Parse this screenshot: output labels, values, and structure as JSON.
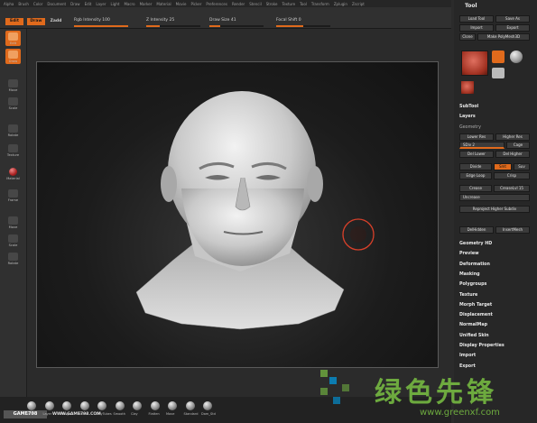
{
  "menu": {
    "items": [
      "Alpha",
      "Brush",
      "Color",
      "Document",
      "Draw",
      "Edit",
      "Layer",
      "Light",
      "Macro",
      "Marker",
      "Material",
      "Movie",
      "Picker",
      "Preferences",
      "Render",
      "Stencil",
      "Stroke",
      "Texture",
      "Tool",
      "Transform",
      "Zplugin",
      "Zscript"
    ]
  },
  "topbar": {
    "edit_label": "Edit",
    "draw_label": "Draw",
    "zadd_label": "Zadd",
    "rgb_intensity": "Rgb Intensity 100",
    "z_intensity": "Z Intensity 25",
    "draw_size": "Draw Size 41",
    "focal_shift": "Focal Shift 0",
    "rgb_fill": 1.0,
    "z_fill": 0.25,
    "draw_fill": 0.2,
    "focal_fill": 0.5
  },
  "right_panel": {
    "header": "Tool",
    "load_tool": "Load Tool",
    "save_as": "Save As",
    "import": "Import",
    "export": "Export",
    "clone": "Clone",
    "make_polymesh": "Make PolyMesh3D",
    "subtool": "SubTool",
    "layers": "Layers",
    "geometry": "Geometry",
    "lower_res": "Lower Res",
    "higher_res": "Higher Res",
    "sdiv": "SDiv 2",
    "cage": "Cage",
    "del_lower": "Del Lower",
    "del_higher": "Del Higher",
    "divide": "Divide",
    "smt": "Smt",
    "suv": "Suv",
    "edge_loop": "Edge Loop",
    "crisp": "Crisp",
    "crease": "Crease",
    "creaselvl": "CreaseLvl 15",
    "uncrease": "Uncrease",
    "reproject": "Reproject Higher Subdiv",
    "delhidden": "DelHidden",
    "insertmesh": "InsertMesh",
    "sections": [
      "Geometry HD",
      "Preview",
      "Deformation",
      "Masking",
      "Polygroups",
      "Texture",
      "Morph Target",
      "Displacement",
      "NormalMap",
      "Unified Skin",
      "Display Properties",
      "Import",
      "Export"
    ]
  },
  "left_shelf": {
    "items": [
      "Edit",
      "Draw",
      "Move",
      "Scale",
      "Rotate",
      "Texture",
      "Material",
      "Frame",
      "Move",
      "Scale",
      "Rotate"
    ]
  },
  "bottom": {
    "logo": "GAME798",
    "url": "WWW.GAME798.COM",
    "brushes": [
      "Inflat",
      "Layer",
      "Nudge",
      "Pinch",
      "ClayTubes",
      "Smooth",
      "Clay",
      "Flatten",
      "Move",
      "Standard",
      "Dam_Std"
    ]
  },
  "watermark": {
    "cn": "绿色先锋",
    "url": "www.greenxf.com"
  }
}
